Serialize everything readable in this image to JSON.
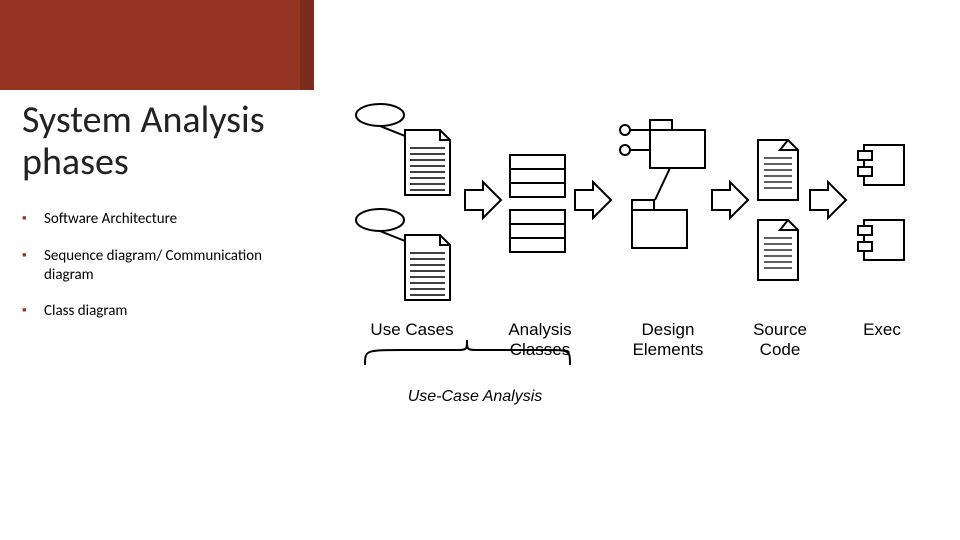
{
  "title_line1": "System Analysis",
  "title_line2": "phases",
  "bullets": [
    "Software Architecture",
    "Sequence diagram/ Communication diagram",
    "Class diagram"
  ],
  "diagram_labels": {
    "use_cases": "Use Cases",
    "analysis_classes_l1": "Analysis",
    "analysis_classes_l2": "Classes",
    "design_elements_l1": "Design",
    "design_elements_l2": "Elements",
    "source_code_l1": "Source",
    "source_code_l2": "Code",
    "exec": "Exec"
  },
  "brace_label": "Use-Case Analysis",
  "chart_data": {
    "type": "diagram",
    "title": "System Analysis phases — process flow",
    "flow": [
      "Use Cases",
      "Analysis Classes",
      "Design Elements",
      "Source Code",
      "Exec"
    ],
    "grouping": {
      "label": "Use-Case Analysis",
      "covers": [
        "Use Cases",
        "Analysis Classes"
      ]
    },
    "left_panel_bullets": [
      "Software Architecture",
      "Sequence diagram/ Communication diagram",
      "Class diagram"
    ]
  }
}
